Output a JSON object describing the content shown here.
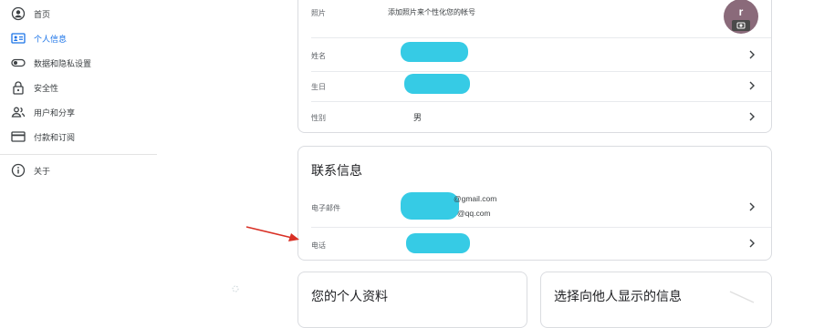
{
  "sidebar": {
    "items": [
      {
        "label": "首页",
        "icon": "account-circle-icon"
      },
      {
        "label": "个人信息",
        "icon": "id-card-icon",
        "active": true
      },
      {
        "label": "数据和隐私设置",
        "icon": "toggle-icon"
      },
      {
        "label": "安全性",
        "icon": "lock-icon"
      },
      {
        "label": "用户和分享",
        "icon": "people-icon"
      },
      {
        "label": "付款和订阅",
        "icon": "credit-card-icon"
      },
      {
        "label": "关于",
        "icon": "info-icon"
      }
    ]
  },
  "basic_info": {
    "photo_label": "照片",
    "photo_hint": "添加照片来个性化您的帐号",
    "avatar_letter": "r",
    "name_label": "姓名",
    "birthday_label": "生日",
    "gender_label": "性别",
    "gender_value": "男"
  },
  "contact_info": {
    "title": "联系信息",
    "email_label": "电子邮件",
    "email_1_suffix": "@gmail.com",
    "email_2_suffix": "@qq.com",
    "phone_label": "电话"
  },
  "bottom_cards": {
    "left_title": "您的个人资料",
    "right_title": "选择向他人显示的信息"
  },
  "colors": {
    "accent": "#1a73e8",
    "redaction": "#36cbe5",
    "arrow": "#d93025"
  }
}
